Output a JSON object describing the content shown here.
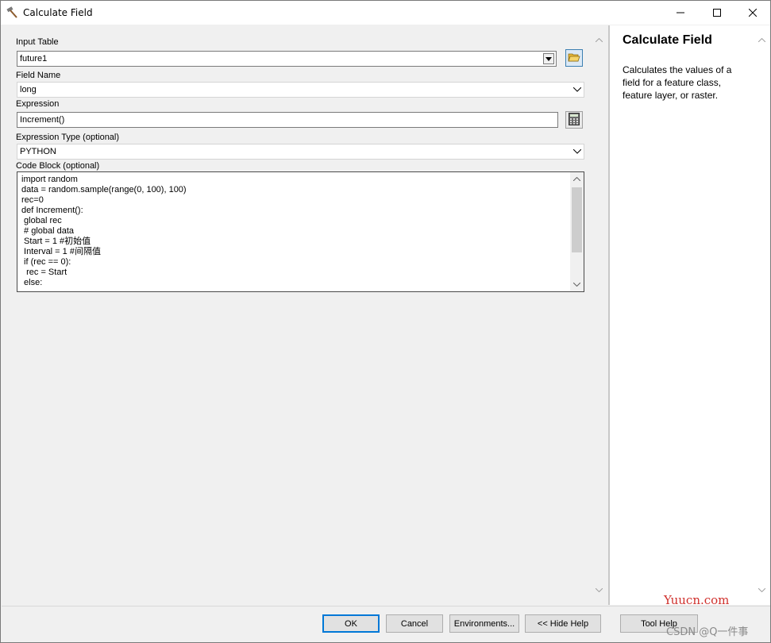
{
  "window": {
    "title": "Calculate Field",
    "icons": {
      "app": "hammer-icon",
      "minimize": "minimize-icon",
      "maximize": "maximize-icon",
      "close": "close-icon"
    }
  },
  "form": {
    "input_table": {
      "label": "Input Table",
      "value": "future1",
      "browse_icon": "open-folder-icon"
    },
    "field_name": {
      "label": "Field Name",
      "value": "long"
    },
    "expression": {
      "label": "Expression",
      "value": "Increment()",
      "builder_icon": "calculator-icon"
    },
    "expression_type": {
      "label": "Expression Type (optional)",
      "value": "PYTHON"
    },
    "code_block": {
      "label": "Code Block (optional)",
      "lines": [
        "import random",
        "data = random.sample(range(0, 100), 100)",
        "rec=0",
        "def Increment():",
        " global rec",
        " # global data",
        " Start = 1 #初始值",
        " Interval = 1 #间隔值",
        " if (rec == 0):",
        "  rec = Start",
        " else:"
      ]
    }
  },
  "help": {
    "title": "Calculate Field",
    "description": "Calculates the values of a field for a feature class, feature layer, or raster."
  },
  "buttons": {
    "ok": "OK",
    "cancel": "Cancel",
    "environments": "Environments...",
    "hide_help": "<< Hide Help",
    "tool_help": "Tool Help"
  },
  "watermarks": {
    "site": "Yuucn.com",
    "credit": "CSDN @Q一件事"
  }
}
